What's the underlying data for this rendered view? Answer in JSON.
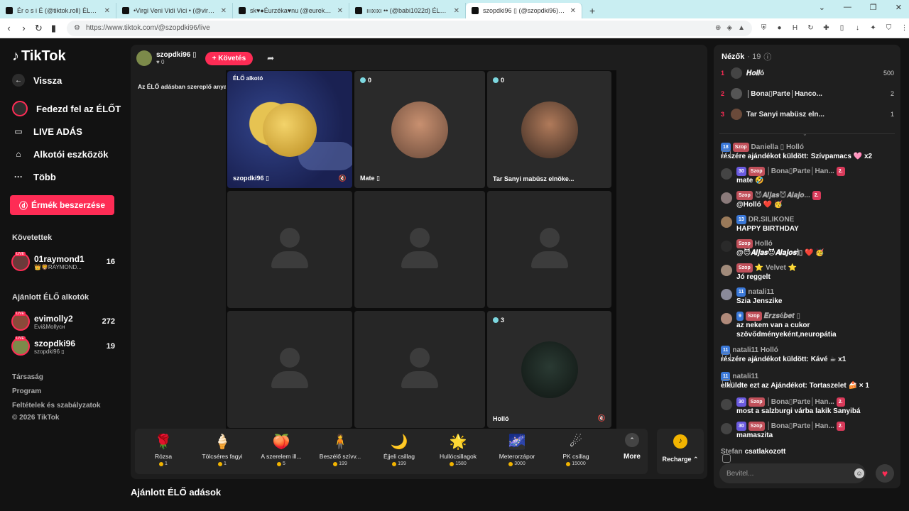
{
  "browser": {
    "tabs": [
      {
        "label": "Ér o s i É (@tiktok.roll) ÉLŐ adi"
      },
      {
        "label": "•Virgi Veni Vidi Vici • (@virgivenividi"
      },
      {
        "label": "sk♥●Éurzéka♥nu (@eurekaeurek"
      },
      {
        "label": "ıııxıxı •• (@babi1022d) ÉLŐ adásban"
      },
      {
        "label": "szopdki96 ▯ (@szopdki96) ÉLŐ"
      }
    ],
    "url": "https://www.tiktok.com/@szopdki96/live"
  },
  "sidebar": {
    "logo": "TikTok",
    "back": "Vissza",
    "nav": [
      {
        "label": "Fedezd fel az ÉLŐT"
      },
      {
        "label": "LIVE ADÁS"
      },
      {
        "label": "Alkotói eszközök"
      },
      {
        "label": "Több"
      }
    ],
    "coins_button": "Érmék beszerzése",
    "following_title": "Követettek",
    "following": [
      {
        "name": "01raymond1",
        "sub": "👑🦁RAYMOND...",
        "count": "16"
      }
    ],
    "recommended_title": "Ajánlott ÉLŐ alkotók",
    "recommended": [
      {
        "name": "evimolly2",
        "sub": "Evi&Mollyсн",
        "count": "272"
      },
      {
        "name": "szopdki96",
        "sub": "szopdki96 ▯",
        "count": "19"
      }
    ],
    "footer": [
      "Társaság",
      "Program",
      "Feltételek és szabályzatok",
      "© 2026 TikTok"
    ]
  },
  "stage": {
    "host_name": "szopdki96 ▯",
    "host_likes": "0",
    "follow_label": "+ Követés",
    "warning": "Az ÉLŐ adásban szereplő anyagok fogyasztása károsí...",
    "live_tag": "ÉLŐ alkotó",
    "cells": [
      {
        "name": "szopdki96 ▯",
        "count": ""
      },
      {
        "name": "Mate ▯",
        "count": "0"
      },
      {
        "name": "Tar Sanyi mabüsz elnöke...",
        "count": "0"
      },
      {
        "name": "Holló",
        "count": "3"
      }
    ]
  },
  "gifts": [
    {
      "name": "Rózsa",
      "price": "1",
      "icon": "rose-icon",
      "glyph": "🌹"
    },
    {
      "name": "Tölcséres fagyi",
      "price": "1",
      "icon": "ice-cream-icon",
      "glyph": "🍦"
    },
    {
      "name": "A szerelem ill...",
      "price": "5",
      "icon": "perfume-icon",
      "glyph": "🍑"
    },
    {
      "name": "Beszélő szívv...",
      "price": "199",
      "icon": "talking-heart-icon",
      "glyph": "🧍"
    },
    {
      "name": "Éjjeli csillag",
      "price": "199",
      "icon": "night-star-icon",
      "glyph": "🌙"
    },
    {
      "name": "Hullócsillagok",
      "price": "1580",
      "icon": "shooting-star-icon",
      "glyph": "🌟"
    },
    {
      "name": "Meterorzápor",
      "price": "3000",
      "icon": "meteor-shower-icon",
      "glyph": "🌌"
    },
    {
      "name": "PK csillag",
      "price": "15000",
      "icon": "pk-star-icon",
      "glyph": "☄"
    }
  ],
  "more_label": "More",
  "recharge_label": "Recharge",
  "recommended_heading": "Ajánlott ÉLŐ adások",
  "chat": {
    "viewers_label": "Nézők",
    "viewers_count": "· 19",
    "top_viewers": [
      {
        "rank": "1",
        "name": "𝑯𝒐𝒍𝒍ó",
        "score": "500"
      },
      {
        "rank": "2",
        "name": "│Bona▯Parte│Hanco...",
        "score": "2"
      },
      {
        "rank": "3",
        "name": "Tar Sanyi mabüsz eln...",
        "score": "1"
      }
    ],
    "messages": [
      {
        "kind": "gift",
        "badges": [
          "18",
          "Szop"
        ],
        "user": "Daniella ▯ Holló",
        "text": "részére ajándékot küldött: Szívpamacs 🩷 x2"
      },
      {
        "kind": "user",
        "badges": [
          "30",
          "Szop"
        ],
        "user": "│Bona▯Parte│Han...",
        "extra": "2.",
        "text": "mate 🤣"
      },
      {
        "kind": "user",
        "badges": [
          "Szop"
        ],
        "user": "😈𝑨𝒍𝒋𝒂𝒔😈𝑨𝒍𝒂𝒋𝒐...",
        "extra": "2.",
        "text": "@Holló ❤️ 🥳"
      },
      {
        "kind": "user",
        "badges": [
          "13"
        ],
        "user": "DR.SILIKONE",
        "text": "HAPPY BIRTHDAY"
      },
      {
        "kind": "user",
        "badges": [
          "Szop"
        ],
        "user": "Holló",
        "text": "@😈𝑨𝒍𝒋𝒂𝒔😈𝑨𝒍𝒂𝒋𝒐𝒔🕯▯ ❤️ 🥳"
      },
      {
        "kind": "user",
        "badges": [
          "Szop"
        ],
        "user": "⭐ Velvet ⭐",
        "text": "Jó reggelt"
      },
      {
        "kind": "user",
        "badges": [
          "11"
        ],
        "user": "natali11",
        "text": "Szia Jenszike"
      },
      {
        "kind": "user",
        "badges": [
          "9",
          "Szop"
        ],
        "user": "𝑬𝒓𝒛𝒔é𝒃𝒆𝒕 ▯",
        "text": "az nekem van a cukor szövődményeként,neuropátia"
      },
      {
        "kind": "gift",
        "badges": [
          "11"
        ],
        "user": "natali11 Holló",
        "text": "részére ajándékot küldött: Kávé ☕ x1"
      },
      {
        "kind": "gift",
        "badges": [
          "11"
        ],
        "user": "natali11",
        "text": "elküldte ezt az Ajándékot: Tortaszelet 🍰 × 1"
      },
      {
        "kind": "user",
        "badges": [
          "30",
          "Szop"
        ],
        "user": "│Bona▯Parte│Han...",
        "extra": "2.",
        "text": "most a salzburgi várba lakik Sanyibá"
      },
      {
        "kind": "user",
        "badges": [
          "30",
          "Szop"
        ],
        "user": "│Bona▯Parte│Han...",
        "extra": "2.",
        "text": "mamaszita"
      },
      {
        "kind": "join",
        "badges": [],
        "user": "Stefan",
        "text": "csatlakozott"
      }
    ],
    "input_placeholder": "Bevitel..."
  }
}
